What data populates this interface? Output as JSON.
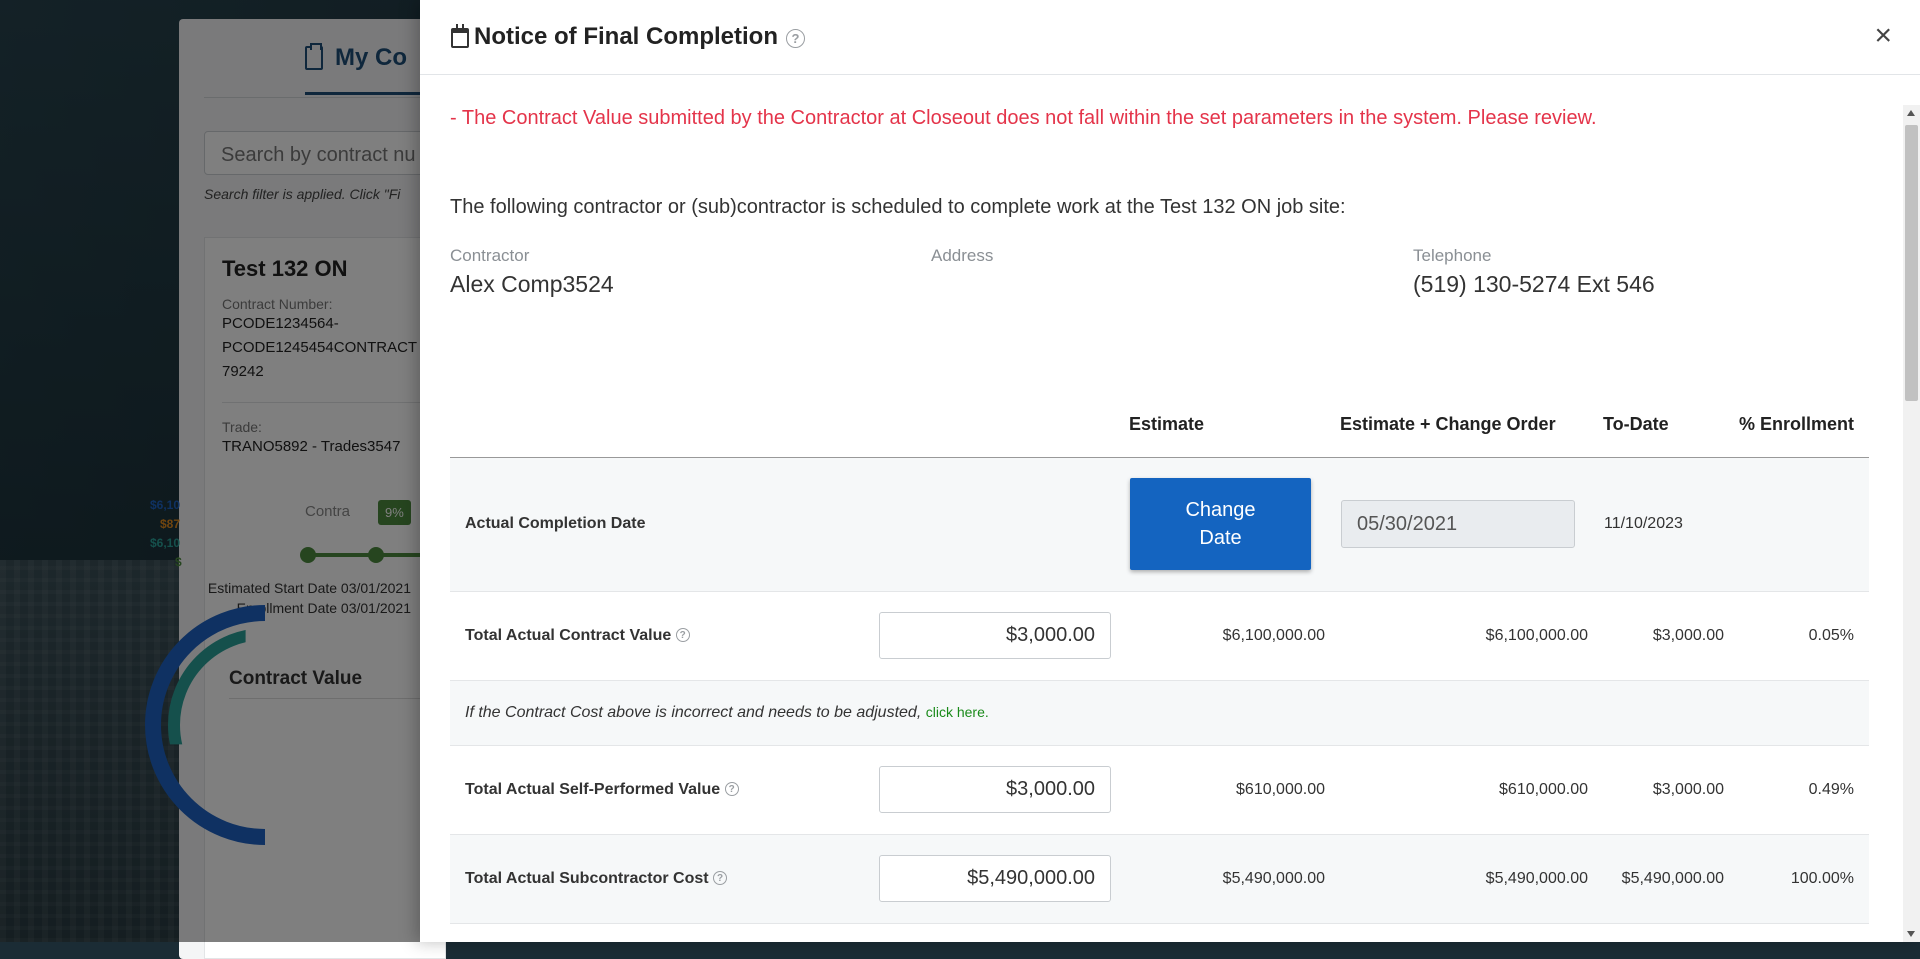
{
  "background": {
    "tab_title": "My Co",
    "search_placeholder": "Search by contract nu",
    "filter_note": "Search filter is applied. Click \"Fi",
    "contract_title": "Test 132 ON",
    "contract_number_label": "Contract Number:",
    "contract_number_lines": [
      "PCODE1234564-",
      "PCODE1245454CONTRACT",
      "79242"
    ],
    "trade_label": "Trade:",
    "trade_value": "TRANO5892 - Trades3547",
    "progress_label": "Contra",
    "progress_pct": "9%",
    "estimated_start": "Estimated Start Date 03/01/2021",
    "enrollment_date": "Enrollment Date 03/01/2021",
    "contract_value_title": "Contract Value",
    "legend": [
      {
        "text": "$6,10",
        "color": "#1e63c4"
      },
      {
        "text": "$87",
        "color": "#e08a1e"
      },
      {
        "text": "$6,10",
        "color": "#2aa198"
      },
      {
        "text": "$",
        "color": "#4c8b3e"
      }
    ]
  },
  "modal": {
    "title": "Notice of Final Completion",
    "close_label": "×",
    "warning": "- The Contract Value submitted by the Contractor at Closeout does not fall within the set parameters in the system. Please review.",
    "intro": "The following contractor or (sub)contractor is scheduled to complete work at the Test 132 ON job site:",
    "contractor_label": "Contractor",
    "contractor_value": "Alex Comp3524",
    "address_label": "Address",
    "address_value": "",
    "telephone_label": "Telephone",
    "telephone_value": "(519) 130-5274 Ext 546",
    "columns": {
      "estimate": "Estimate",
      "estimate_change": "Estimate + Change Order",
      "to_date": "To-Date",
      "enrollment": "% Enrollment"
    },
    "completion_row": {
      "label": "Actual Completion Date",
      "button": "Change\nDate",
      "date_value": "05/30/2021",
      "to_date": "11/10/2023"
    },
    "contract_value_row": {
      "label": "Total Actual Contract Value",
      "input": "$3,000.00",
      "estimate": "$6,100,000.00",
      "estimate_change": "$6,100,000.00",
      "to_date": "$3,000.00",
      "enrollment": "0.05%"
    },
    "note": {
      "text": "If the Contract Cost above is incorrect and needs to be adjusted,",
      "link": "click here."
    },
    "self_performed_row": {
      "label": "Total Actual Self-Performed Value",
      "input": "$3,000.00",
      "estimate": "$610,000.00",
      "estimate_change": "$610,000.00",
      "to_date": "$3,000.00",
      "enrollment": "0.49%"
    },
    "subcontractor_row": {
      "label": "Total Actual Subcontractor Cost",
      "input": "$5,490,000.00",
      "estimate": "$5,490,000.00",
      "estimate_change": "$5,490,000.00",
      "to_date": "$5,490,000.00",
      "enrollment": "100.00%"
    }
  },
  "colors": {
    "warning": "#e4344a",
    "primary_button": "#1464c0",
    "link": "#1a8a1a"
  }
}
